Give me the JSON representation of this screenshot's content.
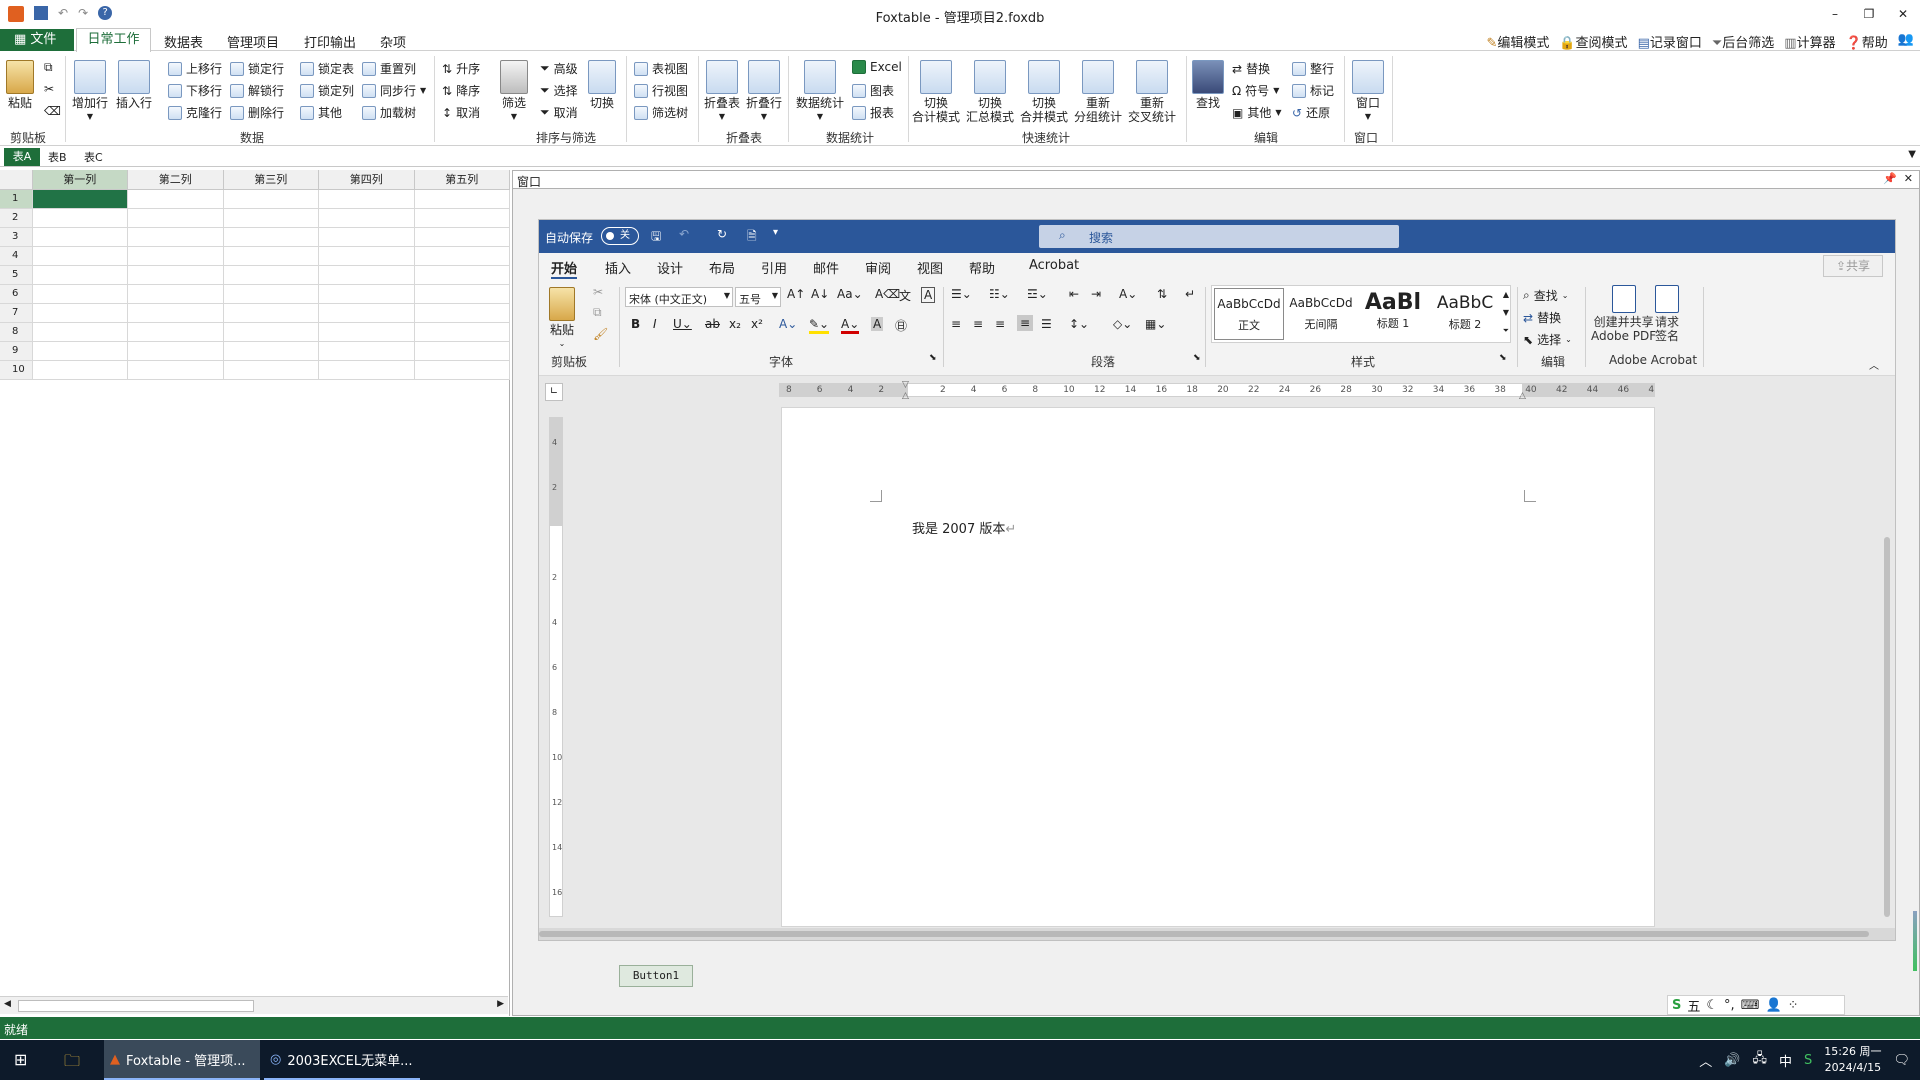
{
  "window": {
    "title": "Foxtable - 管理项目2.foxdb"
  },
  "menu": {
    "file": "文件",
    "tabs": [
      "日常工作",
      "数据表",
      "管理项目",
      "打印输出",
      "杂项"
    ]
  },
  "right_tools": [
    "编辑模式",
    "查阅模式",
    "记录窗口",
    "后台筛选",
    "计算器",
    "帮助"
  ],
  "ribbon": {
    "clipboard": {
      "paste": "粘贴",
      "label": "剪贴板"
    },
    "data": {
      "add_row": "增加行",
      "insert_row": "插入行",
      "up": "上移行",
      "down": "下移行",
      "clone": "克隆行",
      "lock_row": "锁定行",
      "unlock": "解锁行",
      "del_row": "删除行",
      "lock_table": "锁定表",
      "lock_col": "锁定列",
      "other": "其他",
      "reset_col": "重置列",
      "sync": "同步行",
      "loadtree": "加载树",
      "label": "数据"
    },
    "sort": {
      "asc": "升序",
      "desc": "降序",
      "cancel": "取消",
      "filter": "筛选",
      "advanced": "高级",
      "select": "选择",
      "cancel2": "取消",
      "switch": "切换",
      "label": "排序与筛选"
    },
    "views": {
      "table": "表视图",
      "row": "行视图",
      "tree": "筛选树"
    },
    "fold": {
      "fold_table": "折叠表",
      "fold_row": "折叠行",
      "label": "折叠表"
    },
    "stats": {
      "data_stat": "数据统计",
      "excel": "Excel",
      "chart": "图表",
      "report": "报表",
      "label": "数据统计"
    },
    "quick": {
      "b1": "切换\n合计模式",
      "b2": "切换\n汇总模式",
      "b3": "切换\n合并模式",
      "b4": "重新\n分组统计",
      "b5": "重新\n交叉统计",
      "label": "快速统计"
    },
    "edit": {
      "find": "查找",
      "replace": "替换",
      "symbol": "符号",
      "other": "其他",
      "tidy": "整行",
      "mark": "标记",
      "restore": "还原",
      "label": "编辑"
    },
    "window": {
      "win": "窗口",
      "label": "窗口"
    }
  },
  "sheets": [
    "表A",
    "表B",
    "表C"
  ],
  "grid": {
    "columns": [
      "第一列",
      "第二列",
      "第三列",
      "第四列",
      "第五列"
    ],
    "rows": [
      "1",
      "2",
      "3",
      "4",
      "5",
      "6",
      "7",
      "8",
      "9",
      "10"
    ]
  },
  "panel": {
    "title": "窗口",
    "button": "Button1"
  },
  "word": {
    "autosave": "自动保存",
    "toggle": "关",
    "search": "搜索",
    "share": "共享",
    "tabs": [
      "开始",
      "插入",
      "设计",
      "布局",
      "引用",
      "邮件",
      "审阅",
      "视图",
      "帮助",
      "Acrobat"
    ],
    "font_name": "宋体 (中文正文)",
    "font_size": "五号",
    "groups": [
      "剪贴板",
      "字体",
      "段落",
      "样式",
      "编辑",
      "Adobe Acrobat"
    ],
    "paste": "粘贴",
    "styles": [
      {
        "preview": "AaBbCcDd",
        "name": "正文"
      },
      {
        "preview": "AaBbCcDd",
        "name": "无间隔"
      },
      {
        "preview": "AaBl",
        "name": "标题 1"
      },
      {
        "preview": "AaBbC",
        "name": "标题 2"
      }
    ],
    "edit_items": [
      "查找",
      "替换",
      "选择"
    ],
    "acrobat": [
      "创建并共享\nAdobe PDF",
      "请求\n签名"
    ],
    "ruler_top": [
      "8",
      "6",
      "4",
      "2",
      "",
      "2",
      "4",
      "6",
      "8",
      "10",
      "12",
      "14",
      "16",
      "18",
      "20",
      "22",
      "24",
      "26",
      "28",
      "30",
      "32",
      "34",
      "36",
      "38",
      "40",
      "42",
      "44",
      "46",
      "48"
    ],
    "ruler_left": [
      "4",
      "2",
      "",
      "2",
      "4",
      "6",
      "8",
      "10",
      "12",
      "14",
      "16"
    ],
    "body_text": "我是 2007 版本"
  },
  "status": {
    "text": "就绪"
  },
  "ime": [
    "五",
    "中"
  ],
  "taskbar": {
    "apps": [
      "Foxtable - 管理项...",
      "2003EXCEL无菜单..."
    ],
    "lang": "中",
    "time": "15:26 周一",
    "date": "2024/4/15"
  }
}
